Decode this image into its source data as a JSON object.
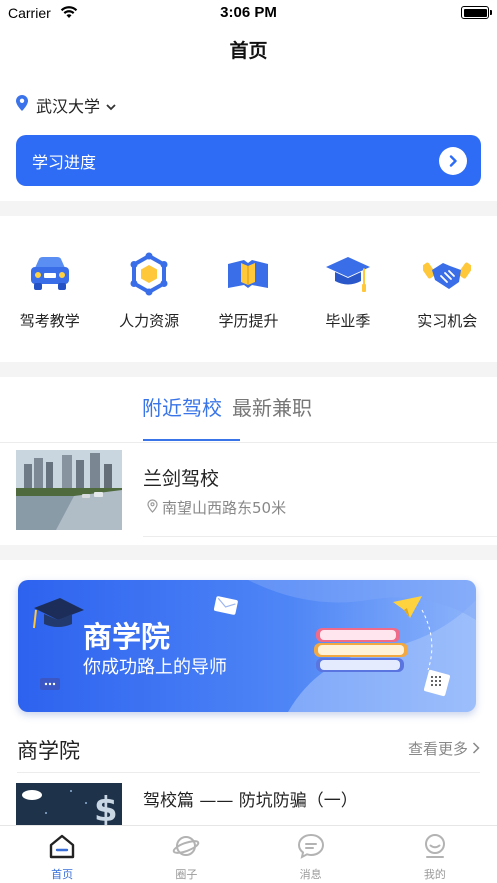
{
  "status_bar": {
    "carrier": "Carrier",
    "time": "3:06 PM"
  },
  "nav": {
    "title": "首页"
  },
  "location": {
    "name": "武汉大学",
    "icon": "location-pin-icon"
  },
  "progress": {
    "label": "学习进度",
    "icon": "chevron-right-icon"
  },
  "categories": [
    {
      "label": "驾考教学",
      "icon": "car-icon"
    },
    {
      "label": "人力资源",
      "icon": "hexagon-network-icon"
    },
    {
      "label": "学历提升",
      "icon": "open-book-icon"
    },
    {
      "label": "毕业季",
      "icon": "graduation-cap-icon"
    },
    {
      "label": "实习机会",
      "icon": "handshake-icon"
    }
  ],
  "tabs": [
    {
      "label": "附近驾校",
      "active": true
    },
    {
      "label": "最新兼职",
      "active": false
    }
  ],
  "school": {
    "name": "兰剑驾校",
    "address": "南望山西路东50米"
  },
  "banner": {
    "title": "商学院",
    "subtitle": "你成功路上的导师"
  },
  "section": {
    "title": "商学院",
    "more": "查看更多"
  },
  "article": {
    "title": "驾校篇 —— 防坑防骗（一）"
  },
  "tabbar": [
    {
      "label": "首页",
      "icon": "home-icon",
      "active": true
    },
    {
      "label": "圈子",
      "icon": "planet-icon",
      "active": false
    },
    {
      "label": "消息",
      "icon": "chat-bubble-icon",
      "active": false
    },
    {
      "label": "我的",
      "icon": "user-icon",
      "active": false
    }
  ],
  "colors": {
    "primary": "#2e6cf6",
    "tab_active": "#3975e8",
    "divider": "#f4f4f4"
  }
}
